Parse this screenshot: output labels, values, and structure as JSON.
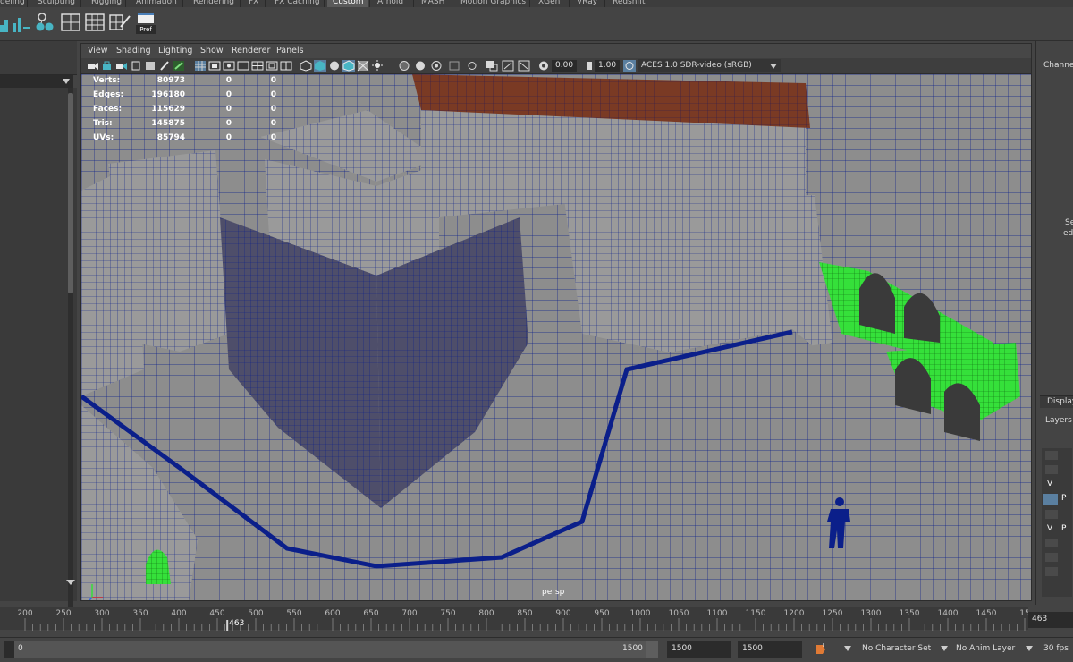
{
  "shelf_tabs": [
    "deling",
    "Sculpting",
    "Rigging",
    "Animation",
    "Rendering",
    "FX",
    "FX Caching",
    "Custom",
    "Arnold",
    "MASH",
    "Motion Graphics",
    "XGen",
    "VRay",
    "Redshift"
  ],
  "shelf_active_tab": "Custom",
  "shelf_pref_label": "Pref",
  "viewport": {
    "menu": [
      "View",
      "Shading",
      "Lighting",
      "Show",
      "Renderer",
      "Panels"
    ],
    "exposure_value": "0.00",
    "gamma_value": "1.00",
    "color_space": "ACES 1.0 SDR-video (sRGB)",
    "camera_label": "persp"
  },
  "hud": [
    {
      "label": "Verts:",
      "value": "80973",
      "sel": "0",
      "comp": "0"
    },
    {
      "label": "Edges:",
      "value": "196180",
      "sel": "0",
      "comp": "0"
    },
    {
      "label": "Faces:",
      "value": "115629",
      "sel": "0",
      "comp": "0"
    },
    {
      "label": "Tris:",
      "value": "145875",
      "sel": "0",
      "comp": "0"
    },
    {
      "label": "UVs:",
      "value": "85794",
      "sel": "0",
      "comp": "0"
    }
  ],
  "right_panel": {
    "channel_label": "Channe",
    "se_label": "Se",
    "ed_label": "ed",
    "display_label": "Display",
    "layers_label": "Layers",
    "v1": "V",
    "p1": "P",
    "v2": "V",
    "p2": "P"
  },
  "timeline": {
    "ticks": [
      "200",
      "250",
      "300",
      "350",
      "400",
      "450",
      "500",
      "550",
      "600",
      "650",
      "700",
      "750",
      "800",
      "850",
      "900",
      "950",
      "1000",
      "1050",
      "1100",
      "1150",
      "1200",
      "1250",
      "1300",
      "1350",
      "1400",
      "1450",
      "15"
    ],
    "current_frame": "463",
    "current_frame_field": "463"
  },
  "range": {
    "start": "0",
    "end_inner": "1500",
    "end_field1": "1500",
    "end_field2": "1500",
    "character_set": "No Character Set",
    "anim_layer": "No Anim Layer",
    "fps": "30 fps"
  },
  "colors": {
    "wire": "#0b1f8a",
    "mesh": "#8f8f8f",
    "selected_mesh": "#35e03a",
    "roof": "#7a3a24",
    "current_frame_marker": "#d6d6d6"
  }
}
